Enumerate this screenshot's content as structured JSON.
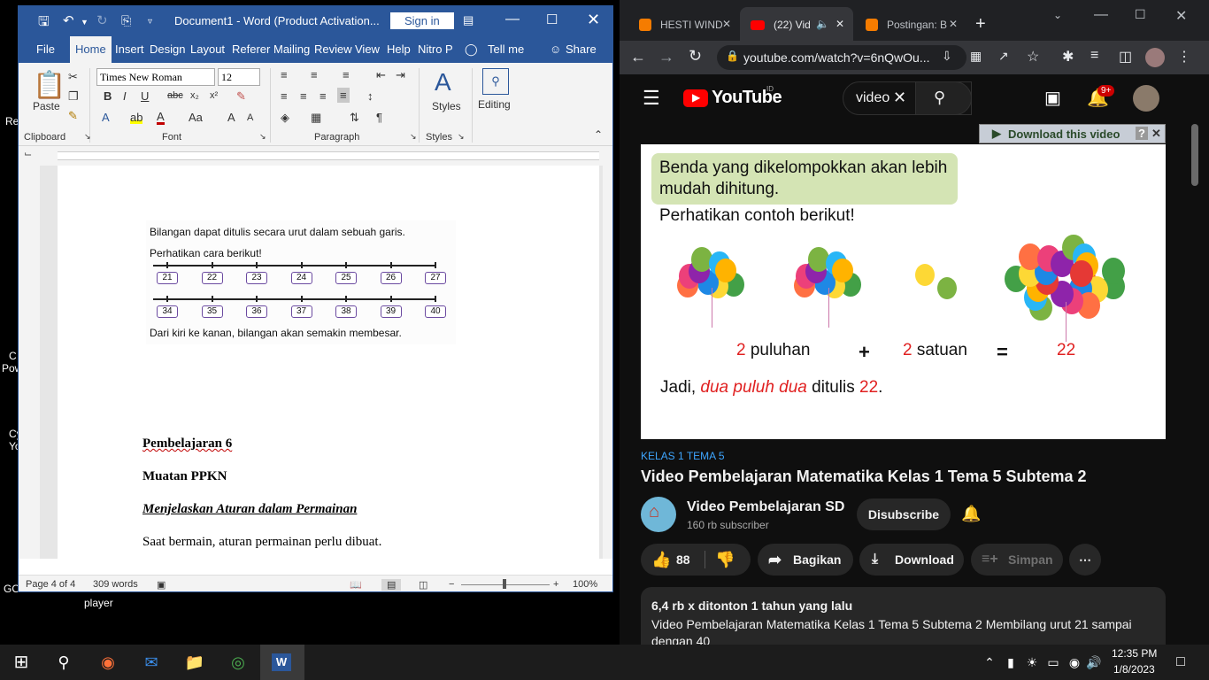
{
  "desktop": {
    "labels": [
      "Re",
      "C",
      "Pow",
      "Cy",
      "Yo",
      "GO",
      "player"
    ]
  },
  "word": {
    "title": "Document1  -  Word (Product Activation...",
    "sign_in": "Sign in",
    "tabs": [
      "File",
      "Home",
      "Insert",
      "Design",
      "Layout",
      "Referer",
      "Mailing",
      "Review",
      "View",
      "Help",
      "Nitro P",
      "Tell me",
      "Share"
    ],
    "ribbon": {
      "paste": "Paste",
      "font_name": "Times New Roman",
      "font_size": "12",
      "styles": "Styles",
      "editing": "Editing",
      "groups": [
        "Clipboard",
        "Font",
        "Paragraph",
        "Styles"
      ]
    },
    "figure": {
      "line1": "Bilangan dapat ditulis secara urut dalam sebuah garis.",
      "line2": "Perhatikan cara berikut!",
      "row1": [
        "21",
        "22",
        "23",
        "24",
        "25",
        "26",
        "27"
      ],
      "row2": [
        "34",
        "35",
        "36",
        "37",
        "38",
        "39",
        "40"
      ],
      "line3": "Dari kiri ke kanan, bilangan akan semakin membesar."
    },
    "doc": {
      "h1": "Pembelajaran 6",
      "h2": "Muatan PPKN",
      "h3": "Menjelaskan Aturan dalam Permainan",
      "p1": "Saat bermain, aturan permainan perlu dibuat."
    },
    "status": {
      "page": "Page 4 of 4",
      "words": "309 words",
      "zoom": "100%"
    }
  },
  "chrome": {
    "tabs": [
      "HESTI WIND",
      "(22) Vid",
      "Postingan: B"
    ],
    "url": "youtube.com/watch?v=6nQwOu...",
    "youtube": {
      "logo": "YouTube",
      "logo_sup": "ID",
      "search": "video",
      "notif_count": "9+",
      "download_bar": "Download this video",
      "video": {
        "box": "Benda yang dikelompokkan akan lebih mudah dihitung.",
        "intro": "Perhatikan contoh berikut!",
        "n1": "2",
        "puluhan": "puluhan",
        "plus": "+",
        "n2": "2",
        "satuan": "satuan",
        "eq": "=",
        "result": "22",
        "jadi": "Jadi,",
        "dua": "dua puluh dua",
        "ditulis": "ditulis",
        "val": "22",
        "dot": "."
      },
      "category": "KELAS 1 TEMA 5",
      "title": "Video Pembelajaran Matematika Kelas 1 Tema 5 Subtema 2",
      "channel": "Video Pembelajaran SD",
      "subs": "160 rb subscriber",
      "subscribe": "Disubscribe",
      "likes": "88",
      "share": "Bagikan",
      "download": "Download",
      "save": "Simpan",
      "views": "6,4 rb x ditonton  1 tahun yang lalu",
      "desc": "Video Pembelajaran Matematika Kelas 1 Tema 5 Subtema 2 Membilang urut 21 sampai dengan 40"
    }
  },
  "taskbar": {
    "time": "12:35 PM",
    "date": "1/8/2023"
  },
  "colors": {
    "word_blue": "#2b579a",
    "yt_red": "#ff0000",
    "red_text": "#e02020"
  }
}
